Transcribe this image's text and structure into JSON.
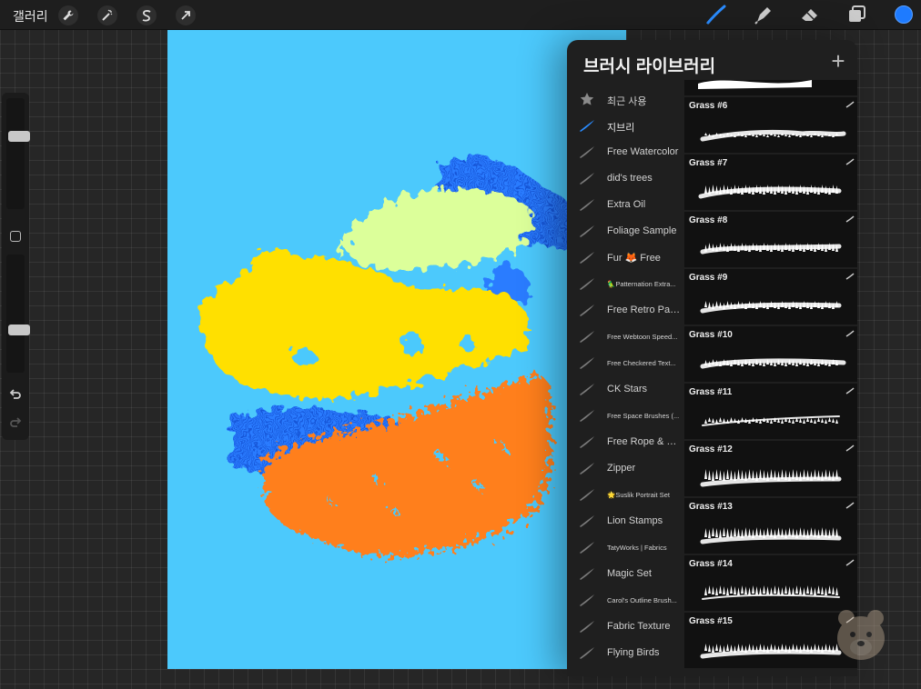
{
  "topbar": {
    "gallery_label": "갤러리",
    "left_tools": [
      "wrench-icon",
      "magic-wand-icon",
      "selection-icon",
      "transform-arrow-icon"
    ],
    "right_tools": [
      "brush-icon",
      "smudge-icon",
      "eraser-icon",
      "layers-icon"
    ],
    "active_color": "#1e7bff"
  },
  "sidebar": {
    "size_level": 0.67,
    "opacity_level": 0.35,
    "tools": [
      "modify-button",
      "undo-icon",
      "redo-icon"
    ]
  },
  "canvas": {
    "background": "#4cc9fc",
    "paint_colors": [
      "#ffe000",
      "#dcff9a",
      "#1e73ff",
      "#ff7f1e"
    ]
  },
  "brush_library": {
    "title": "브러시 라이브러리",
    "add_label": "+",
    "sets": [
      {
        "label": "최근 사용",
        "icon": "star-icon"
      },
      {
        "label": "지브리",
        "icon": "brush-set-icon",
        "active": true
      },
      {
        "label": "Free Watercolor",
        "icon": "brush-set-icon"
      },
      {
        "label": "did's trees",
        "icon": "brush-set-icon"
      },
      {
        "label": "Extra Oil",
        "icon": "brush-set-icon"
      },
      {
        "label": "Foliage Sample",
        "icon": "brush-set-icon"
      },
      {
        "label": "Fur 🦊 Free",
        "icon": "brush-set-icon"
      },
      {
        "label": "🦜Patternation Extra...",
        "icon": "brush-set-icon",
        "small": true
      },
      {
        "label": "Free Retro Pattern",
        "icon": "brush-set-icon"
      },
      {
        "label": "Free Webtoon Speed...",
        "icon": "brush-set-icon",
        "small": true
      },
      {
        "label": "Free Checkered Text...",
        "icon": "brush-set-icon",
        "small": true
      },
      {
        "label": "CK Stars",
        "icon": "brush-set-icon"
      },
      {
        "label": "Free Space Brushes (...",
        "icon": "brush-set-icon",
        "small": true
      },
      {
        "label": "Free Rope & Chain",
        "icon": "brush-set-icon"
      },
      {
        "label": "Zipper",
        "icon": "brush-set-icon"
      },
      {
        "label": "🌟Suslik Portrait Set",
        "icon": "brush-set-icon",
        "small": true
      },
      {
        "label": "Lion Stamps",
        "icon": "brush-set-icon"
      },
      {
        "label": "TatyWorks | Fabrics",
        "icon": "brush-set-icon",
        "small": true
      },
      {
        "label": "Magic Set",
        "icon": "brush-set-icon"
      },
      {
        "label": "Carol's Outline Brush...",
        "icon": "brush-set-icon",
        "small": true
      },
      {
        "label": "Fabric Texture",
        "icon": "brush-set-icon"
      },
      {
        "label": "Flying Birds",
        "icon": "brush-set-icon"
      }
    ],
    "brushes": [
      {
        "name": "Grass #6"
      },
      {
        "name": "Grass #7"
      },
      {
        "name": "Grass #8"
      },
      {
        "name": "Grass #9"
      },
      {
        "name": "Grass #10"
      },
      {
        "name": "Grass #11"
      },
      {
        "name": "Grass #12"
      },
      {
        "name": "Grass #13"
      },
      {
        "name": "Grass #14"
      },
      {
        "name": "Grass #15"
      }
    ]
  }
}
